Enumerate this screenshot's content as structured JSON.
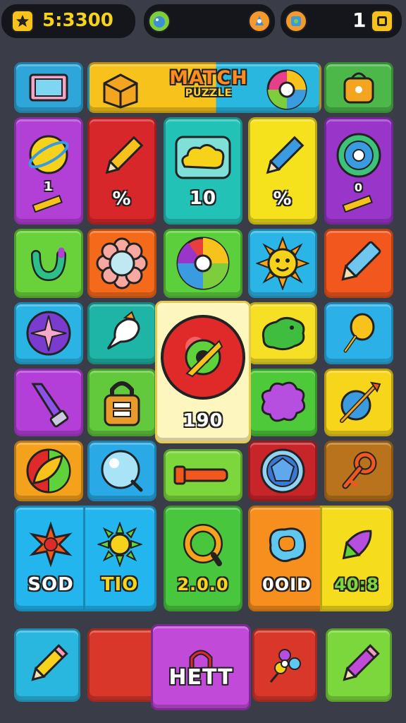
{
  "hud": {
    "score_text": "5:3300",
    "score_icon": "star-icon",
    "powerup_icons": [
      "bomb-icon",
      "rocket-icon",
      "map-icon"
    ],
    "moves_text": "1",
    "moves_icon": "box-icon"
  },
  "banner": {
    "title": "MATCH",
    "subtitle": "PUZZLE"
  },
  "tiles": [
    {
      "icon": "photo-frame-icon",
      "color": "#2fa6d9",
      "label": ""
    },
    {
      "icon": "box-icon",
      "color": "#f6c21b",
      "label": ""
    },
    {
      "icon": "color-wheel-icon",
      "color": "#29b7e0",
      "label": ""
    },
    {
      "icon": "bag-icon",
      "color": "#4cb84a",
      "label": ""
    },
    {
      "icon": "sun-orb-icon",
      "color": "#b23fd6",
      "label": "1"
    },
    {
      "icon": "pencil-icon",
      "color": "#d8272a",
      "label": "%"
    },
    {
      "icon": "cloud-icon",
      "color": "#23c2b7",
      "label": "10"
    },
    {
      "icon": "pencil-icon",
      "color": "#f5e11c",
      "label": "%"
    },
    {
      "icon": "wheel-icon",
      "color": "#9a35c9",
      "label": "0"
    },
    {
      "icon": "hook-icon",
      "color": "#69d23a",
      "label": ""
    },
    {
      "icon": "flower-icon",
      "color": "#f46a1a",
      "label": ""
    },
    {
      "icon": "color-wheel-icon",
      "color": "#5bd03c",
      "label": ""
    },
    {
      "icon": "sun-icon",
      "color": "#2bb4e6",
      "label": ""
    },
    {
      "icon": "marker-icon",
      "color": "#f2571e",
      "label": ""
    },
    {
      "icon": "gem-icon",
      "color": "#2ab4e4",
      "label": ""
    },
    {
      "icon": "brush-icon",
      "color": "#1fb5a6",
      "label": ""
    },
    {
      "icon": "blob-icon",
      "color": "#f5e025",
      "label": ""
    },
    {
      "icon": "pin-icon",
      "color": "#2bb1e8",
      "label": ""
    },
    {
      "icon": "hammer-icon",
      "color": "#b43fd8",
      "label": ""
    },
    {
      "icon": "lock-icon",
      "color": "#62c93d",
      "label": ""
    },
    {
      "icon": "splat-icon",
      "color": "#4ec93a",
      "label": ""
    },
    {
      "icon": "wand-icon",
      "color": "#f7d51a",
      "label": ""
    },
    {
      "icon": "leaf-icon",
      "color": "#f4a11c",
      "label": ""
    },
    {
      "icon": "bubble-icon",
      "color": "#29a9e6",
      "label": ""
    },
    {
      "icon": "bar-icon",
      "color": "#7bd73c",
      "label": ""
    },
    {
      "icon": "gem-ring-icon",
      "color": "#c8252a",
      "label": ""
    },
    {
      "icon": "key-icon",
      "color": "#b8731c",
      "label": ""
    }
  ],
  "feature_tile": {
    "icon": "donut-icon",
    "color": "#fdf6bf",
    "label": "190"
  },
  "bottom_row": [
    {
      "icon": "star-burst-icon",
      "color": "#23b5ee",
      "label": "SOD"
    },
    {
      "icon": "sun-icon",
      "color": "#23b5ee",
      "label": "TIO"
    },
    {
      "icon": "ring-icon",
      "color": "#48c73e",
      "label": "2.0.0"
    },
    {
      "icon": "bean-icon",
      "color": "#f68f1d",
      "label": "0OID"
    },
    {
      "icon": "rocket-icon",
      "color": "#f5dc1d",
      "label": "40:8"
    }
  ],
  "action_bar": {
    "left_icon": "pencil-icon",
    "center_label": "HETT",
    "right_icon": "pencil-icon",
    "mid_icon": "flower-icon"
  }
}
